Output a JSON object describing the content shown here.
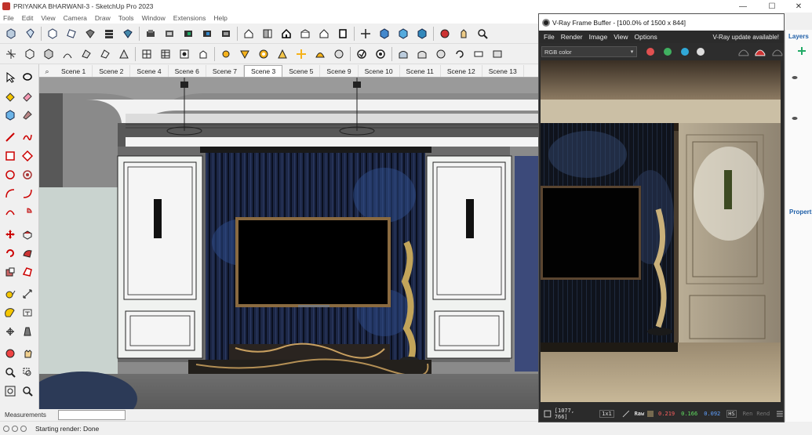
{
  "app": {
    "title": "PRIYANKA BHARWANI-3 - SketchUp Pro 2023",
    "window_controls": [
      "—",
      "☐",
      "✕"
    ]
  },
  "menu": [
    "File",
    "Edit",
    "View",
    "Camera",
    "Draw",
    "Tools",
    "Window",
    "Extensions",
    "Help"
  ],
  "toolbar_icons": {
    "row1": [
      "select-box-icon",
      "eraser-icon",
      "push-pull-icon",
      "offset-icon",
      "paint-icon",
      "layers-stack-icon",
      "walk-icon",
      "warehouse-icon",
      "section-icon",
      "component-icon",
      "house-icon",
      "front-view-icon",
      "iso-view-icon",
      "top-view-icon",
      "right-view-icon",
      "back-view-icon",
      "orbit-icon",
      "pan-icon",
      "zoom-icon"
    ],
    "row2": [
      "move-icon",
      "rotate-icon",
      "scale-icon",
      "follow-me-icon",
      "intersect-icon",
      "outer-shell-icon",
      "grid-icon",
      "table-icon",
      "texture-icon",
      "sandbox-icon",
      "vray-light-icon",
      "sphere-icon",
      "bend-icon",
      "dome-icon",
      "material-icon",
      "render-icon",
      "vfb-icon",
      "fur-icon",
      "proxy-icon"
    ]
  },
  "scenes": {
    "tabs": [
      "Scene 1",
      "Scene 2",
      "Scene 4",
      "Scene 6",
      "Scene 7",
      "Scene 3",
      "Scene 5",
      "Scene 9",
      "Scene 10",
      "Scene 11",
      "Scene 12",
      "Scene 13"
    ],
    "active": "Scene 3"
  },
  "measurements": {
    "label": "Measurements",
    "value": ""
  },
  "status": {
    "text": "Starting render: Done"
  },
  "vfb": {
    "title": "V-Ray Frame Buffer - [100.0% of 1500 x 844]",
    "menu": [
      "File",
      "Render",
      "Image",
      "View",
      "Options"
    ],
    "update_notice": "V-Ray update available!",
    "channel": "RGB color",
    "coords": "[1077, 766]",
    "zoom": "1x1",
    "mode": "Raw",
    "r": "0.219",
    "g": "0.166",
    "b": "0.092",
    "hsv_label": "HS",
    "render_label_1": "Ren",
    "render_label_2": "Rend"
  },
  "layers_panel": {
    "header": "Layers",
    "properties": "Propertie"
  },
  "colors": {
    "red_dot": "#e05050",
    "green_dot": "#40b060",
    "blue_dot": "#30a8d8",
    "r_text": "#ff6060",
    "g_text": "#60e060",
    "b_text": "#60a0ff"
  }
}
